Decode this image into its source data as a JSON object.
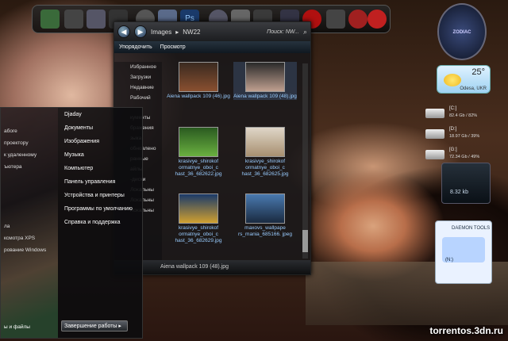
{
  "explorer": {
    "title_path": [
      "Images",
      "NW22"
    ],
    "search_label": "Поиск: NW...",
    "toolbar": {
      "organize": "Упорядочить",
      "view": "Просмотр"
    },
    "sidebar": [
      "Избранное",
      "Загрузки",
      "Недавние",
      "Рабочий",
      "",
      "",
      "кументы",
      "бражения",
      "зыка",
      "обновлено",
      "ранные",
      "айлы",
      "-диски",
      "Локальны",
      "Локальны",
      "Локальны"
    ],
    "files": [
      "Aiena wallpack 109 (46).jpg",
      "Aiena wallpack 109 (48).jpg",
      "krasivye_shirokof ormatnye_oboi_c hast_36_682622.jpg",
      "krasivye_shirokof ormatnye_oboi_c hast_36_682625.jpg",
      "krasivye_shirokof ormatnye_oboi_c hast_36_682629.jpg",
      "maxovs_wallpape rs_mania_685166. jpeg"
    ],
    "status": "Aiena wallpack 109 (48).jpg"
  },
  "start_menu": {
    "user": "Djaday",
    "right_items": [
      "Djaday",
      "Документы",
      "Изображения",
      "Музыка",
      "Компьютер",
      "Панель управления",
      "Устройства и принтеры",
      "Программы по умолчанию",
      "Справка и поддержка"
    ],
    "left_items": [
      "абоге",
      "проектору",
      "к удаленному",
      "ъютера",
      "ла",
      "ксмотра XPS",
      "рование Windows"
    ],
    "search_label": "ы и файлы",
    "shutdown": "Завершение работы"
  },
  "gadgets": {
    "clock_brand": "ZODIAC",
    "weather": {
      "temp": "25°",
      "city": "Odesa, UKR"
    },
    "drives": [
      {
        "label": "[C:]",
        "info": "82.4 Gb / 82%"
      },
      {
        "label": "[D:]",
        "info": "18.97 Gb / 39%"
      },
      {
        "label": "[G:]",
        "info": "72.34 Gb / 49%"
      }
    ],
    "meter_value": "8.32 kb",
    "daemon_brand": "DAEMON TOOLS",
    "daemon_empty": "(N:)"
  },
  "watermark": "torrentos.3dn.ru"
}
